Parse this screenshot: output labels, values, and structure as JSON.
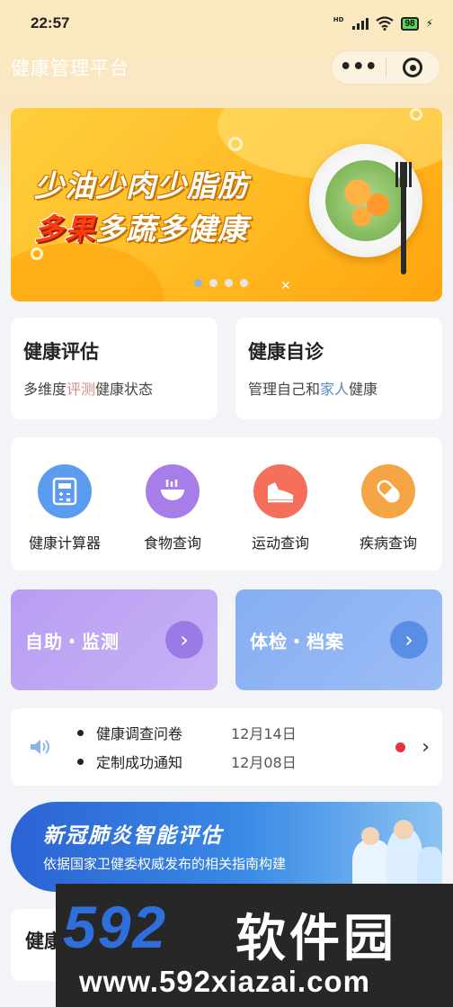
{
  "status_bar": {
    "time": "22:57",
    "network": "HD",
    "battery": "98"
  },
  "nav": {
    "title": "健康管理平台",
    "more_icon": "•••"
  },
  "banner": {
    "line1": "少油少肉少脂肪",
    "line2_highlight": "多果",
    "line2_rest": "多蔬多健康",
    "page_count": 4,
    "active_page": 1
  },
  "cards": {
    "assessment": {
      "title": "健康评估",
      "sub_pre": "多维度",
      "sub_hl": "评测",
      "sub_post": "健康状态"
    },
    "selfcheck": {
      "title": "健康自诊",
      "sub_pre": "管理自己和",
      "sub_hl": "家人",
      "sub_post": "健康"
    }
  },
  "tools": [
    {
      "label": "健康计算器",
      "icon": "calculator-icon",
      "color": "#5b9bf0"
    },
    {
      "label": "食物查询",
      "icon": "bowl-icon",
      "color": "#a77ee8"
    },
    {
      "label": "运动查询",
      "icon": "shoe-icon",
      "color": "#f4705a"
    },
    {
      "label": "疾病查询",
      "icon": "pill-icon",
      "color": "#f6a545"
    }
  ],
  "cta": {
    "monitor": {
      "label": "自助・监测",
      "color": "#b79bf0"
    },
    "archive": {
      "label": "体检・档案",
      "color": "#7fa9f2"
    }
  },
  "notices": [
    {
      "text": "健康调查问卷",
      "date": "12月14日"
    },
    {
      "text": "定制成功通知",
      "date": "12月08日"
    }
  ],
  "covid": {
    "title": "新冠肺炎智能评估",
    "subtitle": "依据国家卫健委权威发布的相关指南构建"
  },
  "peek": {
    "title": "健康"
  },
  "watermark": {
    "big": "592",
    "cn": "软件园",
    "url": "www.592xiazai.com"
  }
}
